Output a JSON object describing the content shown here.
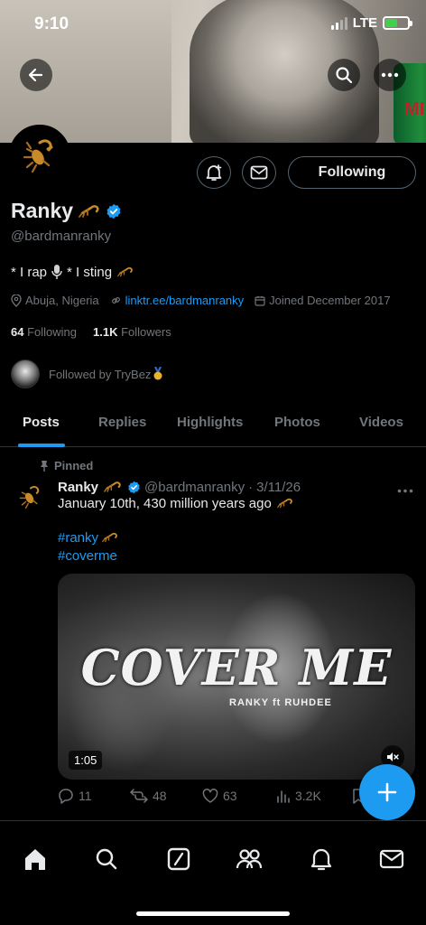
{
  "status_bar": {
    "time": "9:10",
    "network": "LTE"
  },
  "banner": {
    "can_text": "MI"
  },
  "profile": {
    "name": "Ranky",
    "handle": "@bardmanranky",
    "bio_part1": "* I rap",
    "bio_part2": "* I sting",
    "location": "Abuja, Nigeria",
    "link": "linktr.ee/bardmanranky",
    "joined": "Joined December 2017",
    "following_count": "64",
    "following_label": "Following",
    "followers_count": "1.1K",
    "followers_label": "Followers",
    "followed_by": "Followed by TryBez",
    "follow_button_label": "Following"
  },
  "tabs": [
    {
      "label": "Posts",
      "active": true
    },
    {
      "label": "Replies",
      "active": false
    },
    {
      "label": "Highlights",
      "active": false
    },
    {
      "label": "Photos",
      "active": false
    },
    {
      "label": "Videos",
      "active": false
    }
  ],
  "pinned_post": {
    "pinned_label": "Pinned",
    "author_name": "Ranky",
    "author_handle": "@bardmanranky",
    "date": "3/11/26",
    "text": "January 10th, 430 million years ago",
    "hashtag1": "#ranky",
    "hashtag2": "#coverme",
    "video": {
      "title": "COVER ME",
      "subtitle": "RANKY ft RUHDEE",
      "duration": "1:05"
    },
    "stats": {
      "replies": "11",
      "reposts": "48",
      "likes": "63",
      "views": "3.2K"
    }
  },
  "colors": {
    "accent": "#1d9bf0",
    "verified": "#1d9bf0",
    "background": "#000000",
    "muted": "#71767b"
  },
  "icons": [
    "back-arrow-icon",
    "search-icon",
    "more-icon",
    "scorpion-icon",
    "notify-bell-icon",
    "mail-icon",
    "location-icon",
    "link-icon",
    "calendar-icon",
    "pin-icon",
    "verified-badge-icon",
    "mic-icon",
    "medal-icon",
    "reply-icon",
    "repost-icon",
    "like-icon",
    "views-icon",
    "bookmark-icon",
    "mute-icon",
    "compose-plus-icon",
    "home-icon",
    "grok-icon",
    "people-icon",
    "bell-icon"
  ]
}
